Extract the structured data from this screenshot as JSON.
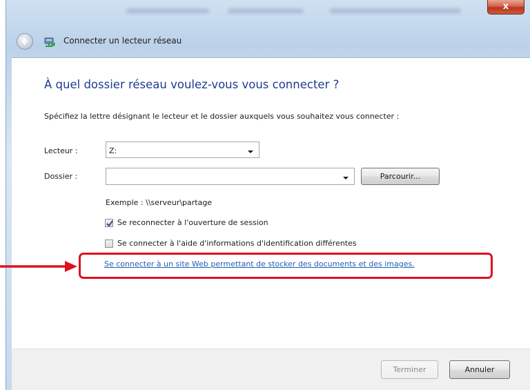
{
  "window": {
    "close_glyph": "x",
    "close_color": "#c9452c",
    "glass_color": "#c6d9ee"
  },
  "nav": {
    "title": "Connecter un lecteur réseau",
    "back_icon": "back-arrow-icon",
    "title_icon": "network-drive-icon"
  },
  "main": {
    "heading": "À quel dossier réseau voulez-vous vous connecter ?",
    "description": "Spécifiez la lettre désignant le lecteur et le dossier auxquels vous souhaitez vous connecter :",
    "drive": {
      "label": "Lecteur :",
      "value": "Z:"
    },
    "folder": {
      "label": "Dossier :",
      "value": ""
    },
    "browse_button": "Parcourir...",
    "example": "Exemple : \\\\serveur\\partage",
    "reconnect": {
      "label": "Se reconnecter à l'ouverture de session",
      "checked": true
    },
    "other_credentials": {
      "label": "Se connecter à l'aide d'informations d'identification différentes",
      "checked": false
    },
    "web_link": "Se connecter à un site Web permettant de stocker des documents et des images."
  },
  "footer": {
    "finish_button": "Terminer",
    "cancel_button": "Annuler"
  },
  "annotation": {
    "color": "#e0101e"
  }
}
